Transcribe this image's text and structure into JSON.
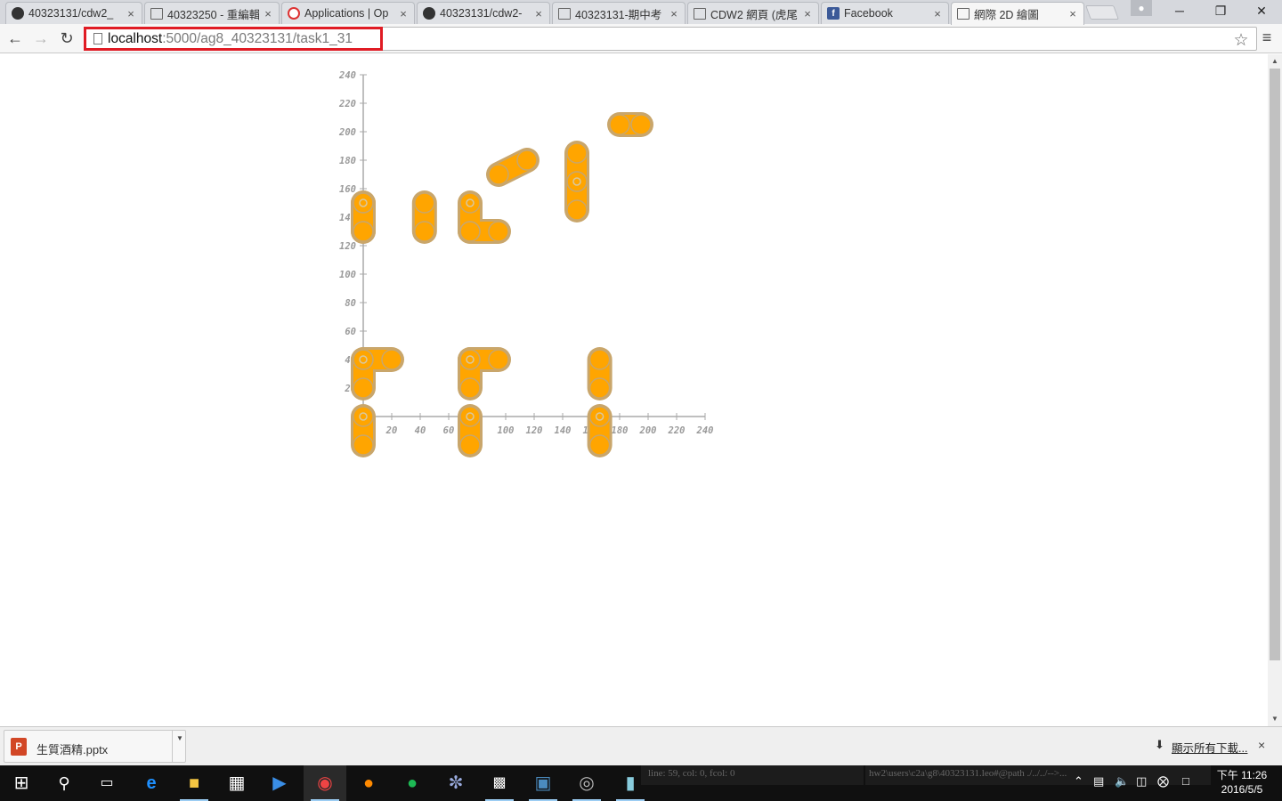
{
  "tabs": [
    {
      "title": "40323131/cdw2_",
      "favicon": "github-icon",
      "active": false
    },
    {
      "title": "40323250 - 重編輯",
      "favicon": "document-icon",
      "active": false
    },
    {
      "title": "Applications | Op",
      "favicon": "openshift-icon",
      "active": false
    },
    {
      "title": "40323131/cdw2-",
      "favicon": "github-icon",
      "active": false
    },
    {
      "title": "40323131-期中考",
      "favicon": "document-icon",
      "active": false
    },
    {
      "title": "CDW2 網頁 (虎尾",
      "favicon": "document-icon",
      "active": false
    },
    {
      "title": "Facebook",
      "favicon": "facebook-icon",
      "active": false
    },
    {
      "title": "網際 2D 繪圖",
      "favicon": "document-icon",
      "active": true
    }
  ],
  "tab_close_glyph": "×",
  "window_controls": {
    "minimize": "─",
    "restore": "❐",
    "close": "✕"
  },
  "address_bar": {
    "host": "localhost",
    "path": ":5000/ag8_40323131/task1_31"
  },
  "plot": {
    "x_ticks": [
      "20",
      "40",
      "60",
      "80",
      "100",
      "120",
      "140",
      "160",
      "180",
      "200",
      "220",
      "240"
    ],
    "y_ticks": [
      "20",
      "40",
      "60",
      "80",
      "100",
      "120",
      "140",
      "160",
      "180",
      "200",
      "220",
      "240"
    ],
    "origin_label": "0",
    "link_color": "#FFA500",
    "outline_color": "#C9A66B",
    "axis_color": "#AAAAAA",
    "links": [
      [
        0,
        150,
        0,
        130
      ],
      [
        0,
        130,
        0,
        150
      ],
      [
        43,
        150,
        43,
        130
      ],
      [
        75,
        150,
        75,
        130
      ],
      [
        75,
        130,
        95,
        130
      ],
      [
        95,
        170,
        115,
        180
      ],
      [
        150,
        185,
        150,
        165
      ],
      [
        150,
        165,
        150,
        145
      ],
      [
        180,
        205,
        195,
        205
      ],
      [
        0,
        40,
        0,
        20
      ],
      [
        0,
        40,
        20,
        40
      ],
      [
        75,
        40,
        75,
        20
      ],
      [
        75,
        40,
        95,
        40
      ],
      [
        166,
        40,
        166,
        20
      ],
      [
        0,
        0,
        0,
        -20
      ],
      [
        75,
        0,
        75,
        -20
      ],
      [
        166,
        0,
        166,
        -20
      ]
    ],
    "pivots": [
      [
        0,
        150
      ],
      [
        75,
        150
      ],
      [
        150,
        165
      ],
      [
        0,
        0
      ],
      [
        75,
        0
      ],
      [
        166,
        0
      ],
      [
        0,
        40
      ],
      [
        75,
        40
      ]
    ]
  },
  "downloads": {
    "filename": "生質酒精.pptx",
    "show_all": "顯示所有下載...",
    "close": "×"
  },
  "taskbar": {
    "apps": [
      "windows-start-icon",
      "search-icon",
      "task-view-icon",
      "edge-icon",
      "file-explorer-icon",
      "store-icon",
      "media-player-icon",
      "chrome-icon",
      "firefox-icon",
      "spotify-icon",
      "paint-icon",
      "cmd-icon",
      "python-icon",
      "sphere-app-icon",
      "notepad-icon"
    ],
    "editor_status": "line: 59, col: 0, fcol: 0",
    "editor_path": "hw2\\users\\c2a\\g8\\40323131.leo#@path ./../../-->...",
    "clock_time": "下午 11:26",
    "clock_date": "2016/5/5"
  }
}
